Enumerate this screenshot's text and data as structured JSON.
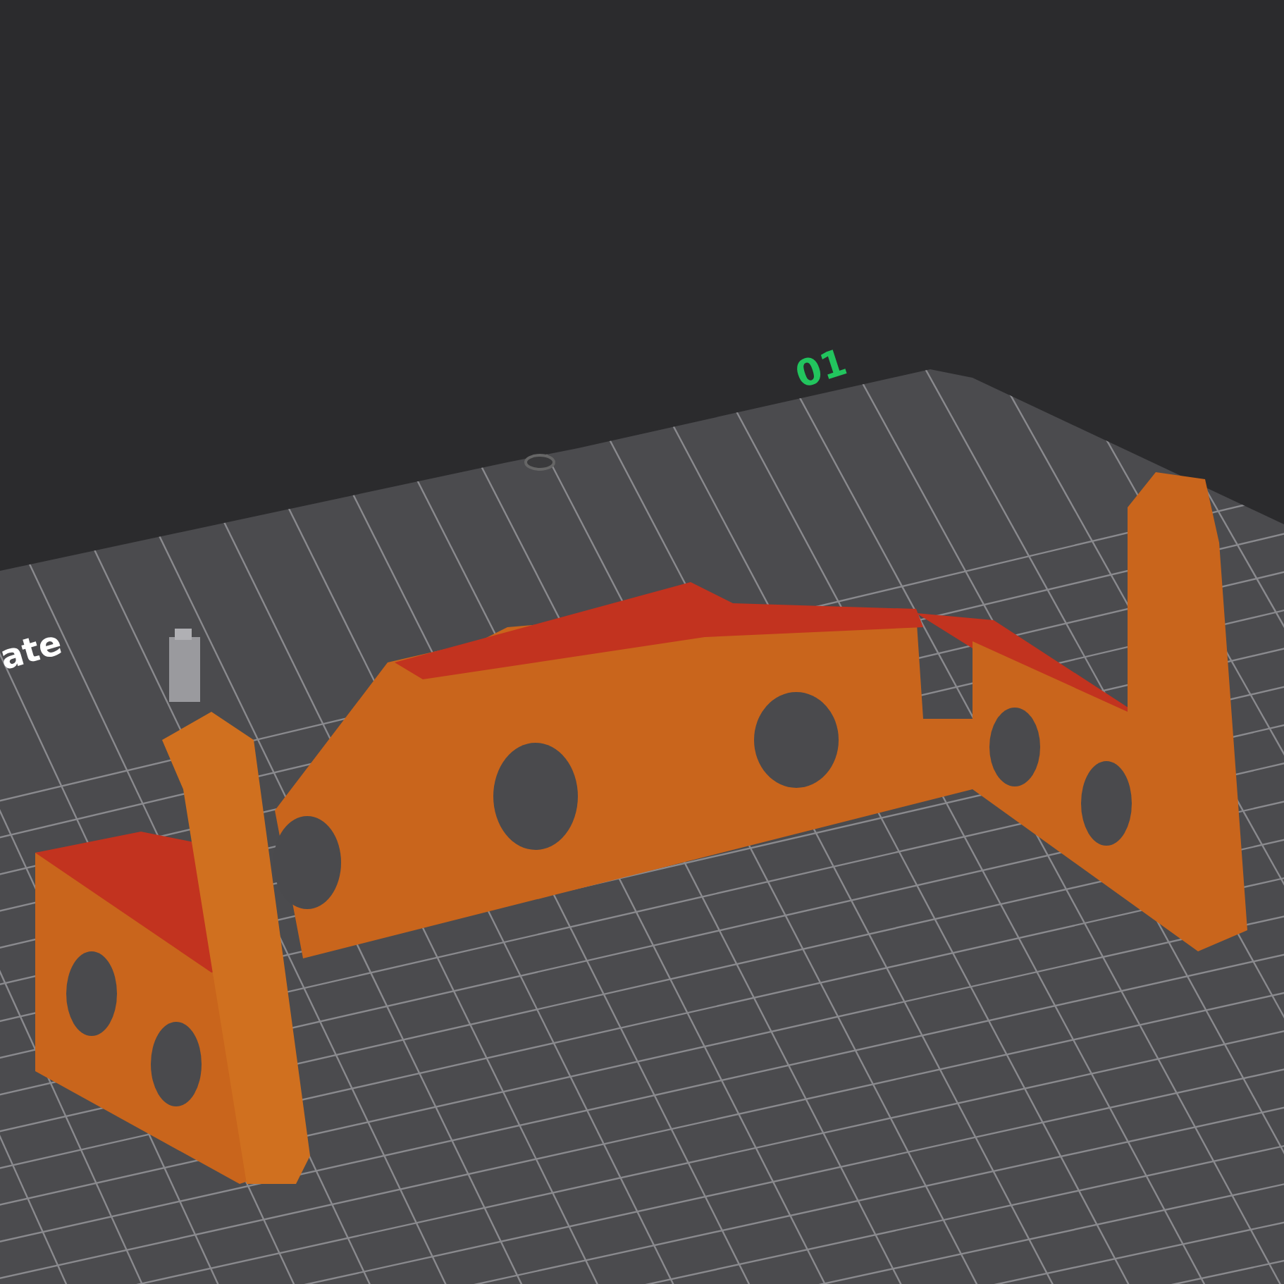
{
  "viewport": {
    "plate_number": "01",
    "plate_label": "ate"
  }
}
